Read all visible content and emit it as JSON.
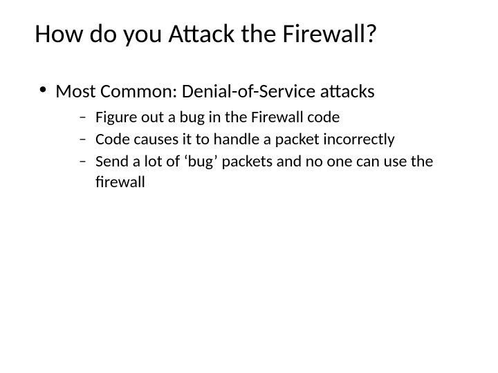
{
  "slide": {
    "title": "How do you Attack the Firewall?",
    "bullets": [
      {
        "text": "Most Common: Denial-of-Service attacks",
        "children": [
          "Figure out a bug in the Firewall code",
          "Code causes it to handle a packet incorrectly",
          "Send a lot of ‘bug’ packets and no one can use the firewall"
        ]
      }
    ]
  }
}
